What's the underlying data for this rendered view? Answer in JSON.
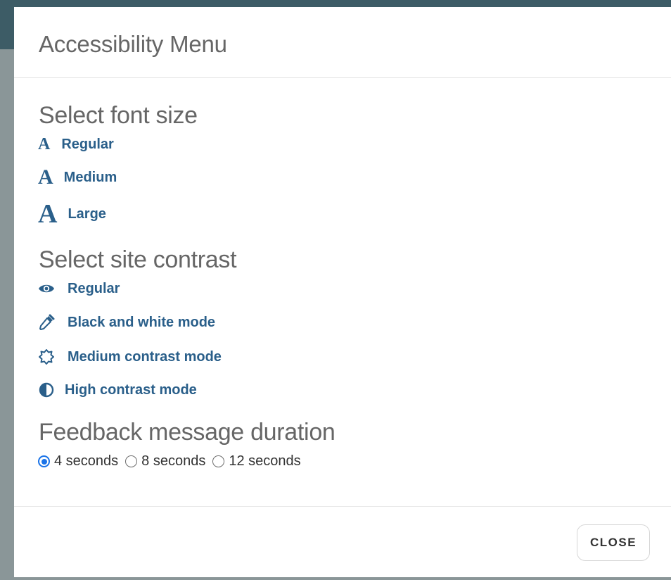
{
  "modal": {
    "title": "Accessibility Menu"
  },
  "font_size": {
    "heading": "Select font size",
    "options": [
      {
        "glyph": "A",
        "label": "Regular"
      },
      {
        "glyph": "A",
        "label": "Medium"
      },
      {
        "glyph": "A",
        "label": "Large"
      }
    ]
  },
  "contrast": {
    "heading": "Select site contrast",
    "options": [
      {
        "icon": "eye-icon",
        "label": "Regular"
      },
      {
        "icon": "eyedropper-icon",
        "label": "Black and white mode"
      },
      {
        "icon": "sun-outline-icon",
        "label": "Medium contrast mode"
      },
      {
        "icon": "half-circle-icon",
        "label": "High contrast mode"
      }
    ]
  },
  "feedback": {
    "heading": "Feedback message duration",
    "options": [
      {
        "label": "4 seconds",
        "checked": true
      },
      {
        "label": "8 seconds",
        "checked": false
      },
      {
        "label": "12 seconds",
        "checked": false
      }
    ]
  },
  "footer": {
    "close_label": "CLOSE"
  },
  "colors": {
    "link": "#2a5f8a",
    "heading": "#666666",
    "radio_accent": "#1a73e8",
    "backdrop": "#8a9698",
    "backdrop_header": "#3d5c66"
  }
}
